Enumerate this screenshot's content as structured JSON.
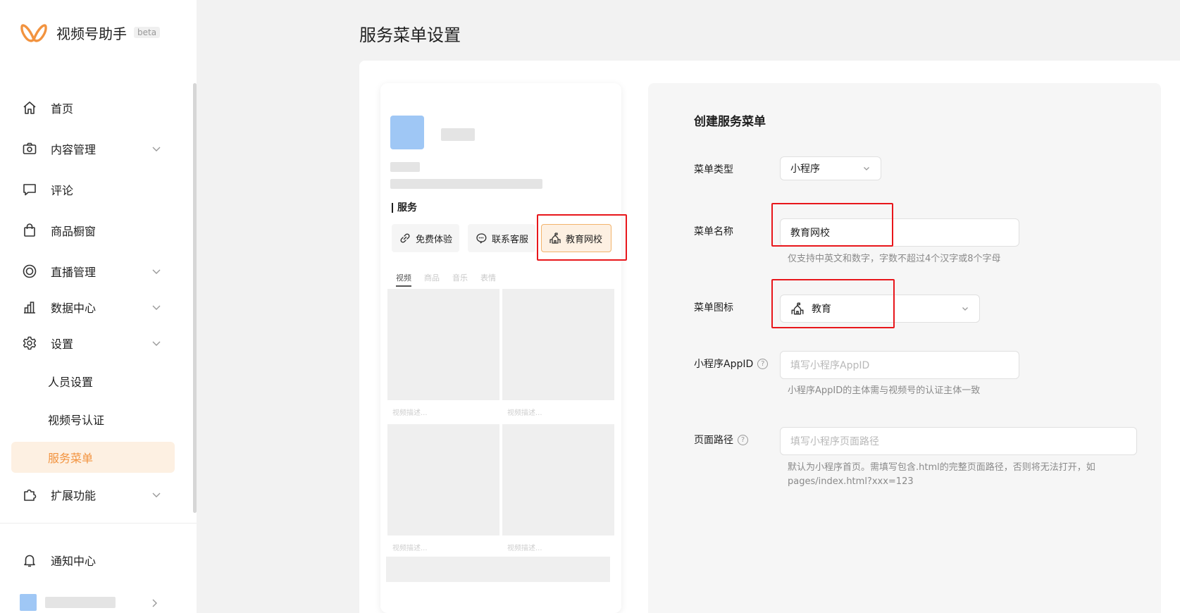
{
  "app": {
    "name": "视频号助手",
    "badge": "beta"
  },
  "colors": {
    "accent": "#f2933f",
    "highlight": "#e8161b"
  },
  "sidebar": {
    "items": [
      {
        "label": "首页",
        "icon": "home-icon"
      },
      {
        "label": "内容管理",
        "icon": "camera-icon"
      },
      {
        "label": "评论",
        "icon": "comment-icon"
      },
      {
        "label": "商品橱窗",
        "icon": "bag-icon"
      },
      {
        "label": "直播管理",
        "icon": "live-icon"
      },
      {
        "label": "数据中心",
        "icon": "chart-icon"
      },
      {
        "label": "设置",
        "icon": "gear-icon"
      }
    ],
    "sub_items": [
      "人员设置",
      "视频号认证",
      "服务菜单"
    ],
    "extension": {
      "label": "扩展功能",
      "icon": "puzzle-icon"
    },
    "notification": {
      "label": "通知中心",
      "icon": "bell-icon"
    }
  },
  "page": {
    "title": "服务菜单设置"
  },
  "preview": {
    "service_title": "服务",
    "buttons": [
      {
        "label": "免费体验",
        "icon": "link-icon"
      },
      {
        "label": "联系客服",
        "icon": "chat-icon"
      },
      {
        "label": "教育网校",
        "icon": "school-icon"
      }
    ],
    "tabs": [
      "视频",
      "商品",
      "音乐",
      "表情"
    ],
    "video_caption": "视频描述..."
  },
  "form": {
    "title": "创建服务菜单",
    "menu_type": {
      "label": "菜单类型",
      "value": "小程序"
    },
    "menu_name": {
      "label": "菜单名称",
      "value": "教育网校",
      "hint": "仅支持中英文和数字，字数不超过4个汉字或8个字母"
    },
    "menu_icon": {
      "label": "菜单图标",
      "value": "教育"
    },
    "appid": {
      "label": "小程序AppID",
      "placeholder": "填写小程序AppID",
      "hint": "小程序AppID的主体需与视频号的认证主体一致"
    },
    "path": {
      "label": "页面路径",
      "placeholder": "填写小程序页面路径",
      "hint_line1": "默认为小程序首页。需填写包含.html的完整页面路径，否则将无法打开，如",
      "hint_line2": "pages/index.html?xxx=123"
    }
  }
}
